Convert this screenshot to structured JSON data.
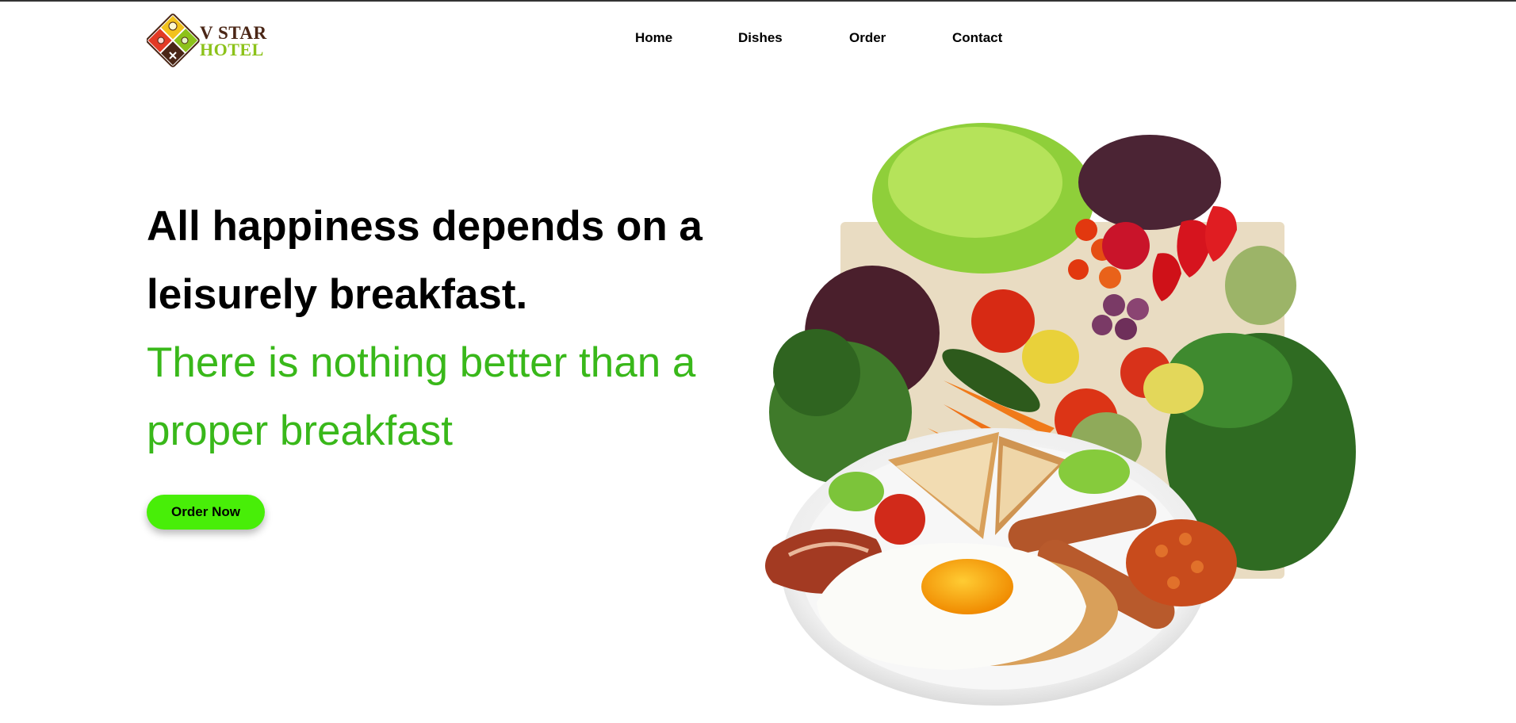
{
  "brand": {
    "line1": "V STAR",
    "line2": "HOTEL",
    "colors": {
      "brown": "#4a2616",
      "green": "#8cc21a",
      "red": "#e23a25",
      "yellow": "#f2c21c"
    }
  },
  "nav": {
    "items": [
      {
        "label": "Home"
      },
      {
        "label": "Dishes"
      },
      {
        "label": "Order"
      },
      {
        "label": "Contact"
      }
    ]
  },
  "hero": {
    "title": "All happiness depends on a leisurely breakfast.",
    "subtitle": "There is nothing better than a proper breakfast",
    "cta_label": "Order Now",
    "accent_color": "#39b81a",
    "button_color": "#48ee08"
  },
  "image": {
    "subject": "breakfast-plate-with-vegetables"
  }
}
